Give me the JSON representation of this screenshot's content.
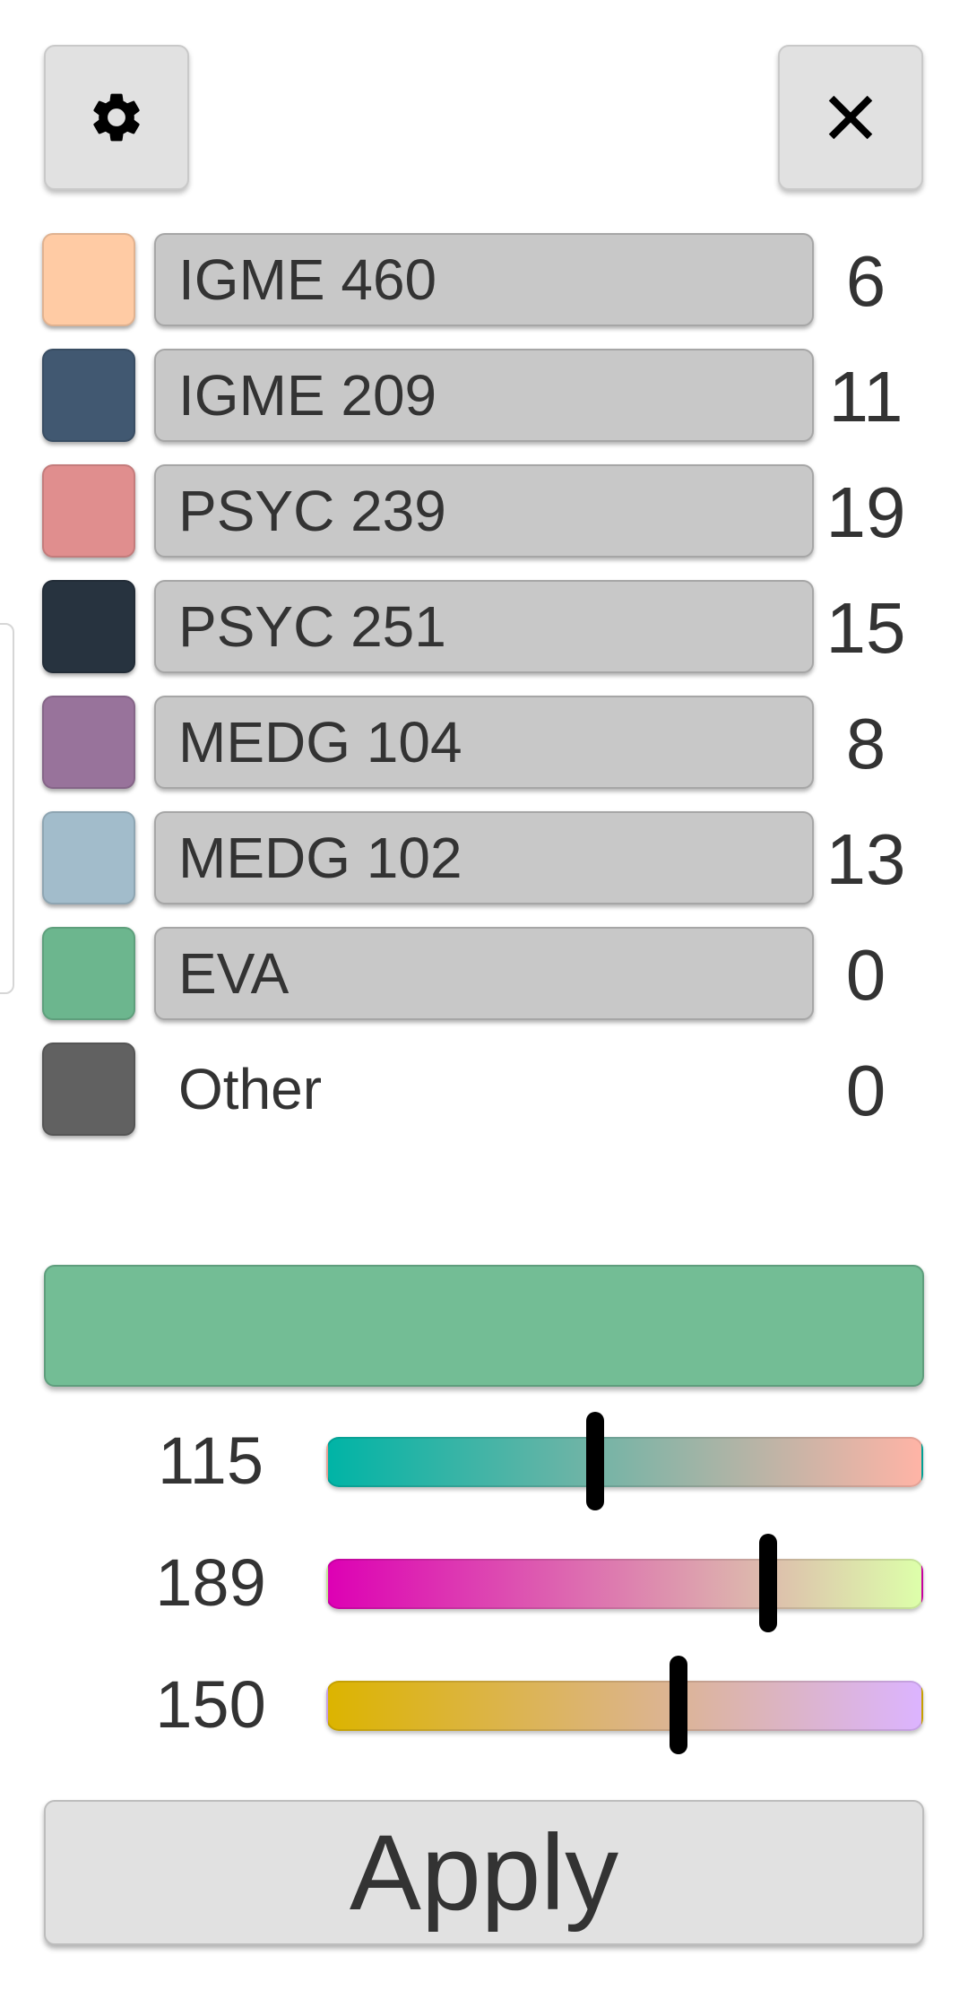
{
  "header": {
    "settings_icon": "gear-icon",
    "close_icon": "close-icon"
  },
  "categories": [
    {
      "name": "IGME 460",
      "count": "6",
      "color": "#ffcba4",
      "editable": true
    },
    {
      "name": "IGME 209",
      "count": "11",
      "color": "#415871",
      "editable": true
    },
    {
      "name": "PSYC 239",
      "count": "19",
      "color": "#e08e8e",
      "editable": true
    },
    {
      "name": "PSYC 251",
      "count": "15",
      "color": "#27333f",
      "editable": true
    },
    {
      "name": "MEDG 104",
      "count": "8",
      "color": "#98739b",
      "editable": true
    },
    {
      "name": "MEDG 102",
      "count": "13",
      "color": "#a2bccb",
      "editable": true
    },
    {
      "name": "EVA",
      "count": "0",
      "color": "#6cb68e",
      "editable": true
    },
    {
      "name": "Other",
      "count": "0",
      "color": "#616161",
      "editable": false
    }
  ],
  "color_editor": {
    "preview_color": "#73bd95",
    "sliders": [
      {
        "value": "115",
        "fraction": 0.45,
        "gradient_start": "#00b4a6",
        "gradient_end": "#ffb4a6"
      },
      {
        "value": "189",
        "fraction": 0.74,
        "gradient_start": "#dd00b4",
        "gradient_end": "#ddffaa"
      },
      {
        "value": "150",
        "fraction": 0.59,
        "gradient_start": "#dcb400",
        "gradient_end": "#dcb4ff"
      }
    ]
  },
  "apply": {
    "label": "Apply"
  }
}
